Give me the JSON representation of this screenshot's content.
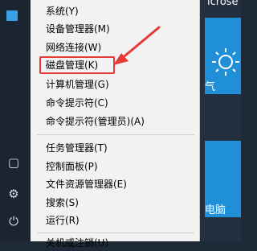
{
  "left_strip": {
    "icons": [
      "app-icon",
      "document-icon",
      "settings-icon",
      "power-icon"
    ]
  },
  "tiles": {
    "top_label": "icrose",
    "weather_label": "气",
    "pc_label": "电脑"
  },
  "context_menu": {
    "groups": [
      [
        {
          "label": "系统(Y)"
        },
        {
          "label": "设备管理器(M)"
        },
        {
          "label": "网络连接(W)"
        },
        {
          "label": "磁盘管理(K)"
        },
        {
          "label": "计算机管理(G)"
        },
        {
          "label": "命令提示符(C)"
        },
        {
          "label": "命令提示符(管理员)(A)"
        }
      ],
      [
        {
          "label": "任务管理器(T)"
        },
        {
          "label": "控制面板(P)"
        },
        {
          "label": "文件资源管理器(E)"
        },
        {
          "label": "搜索(S)"
        },
        {
          "label": "运行(R)"
        }
      ],
      [
        {
          "label": "关机或注销(U)"
        }
      ]
    ]
  },
  "colors": {
    "menu_bg": "#f2f2f2",
    "highlight": "#e53935",
    "tile_blue": "#1f8fd8",
    "dark_bg": "#1b2431"
  }
}
